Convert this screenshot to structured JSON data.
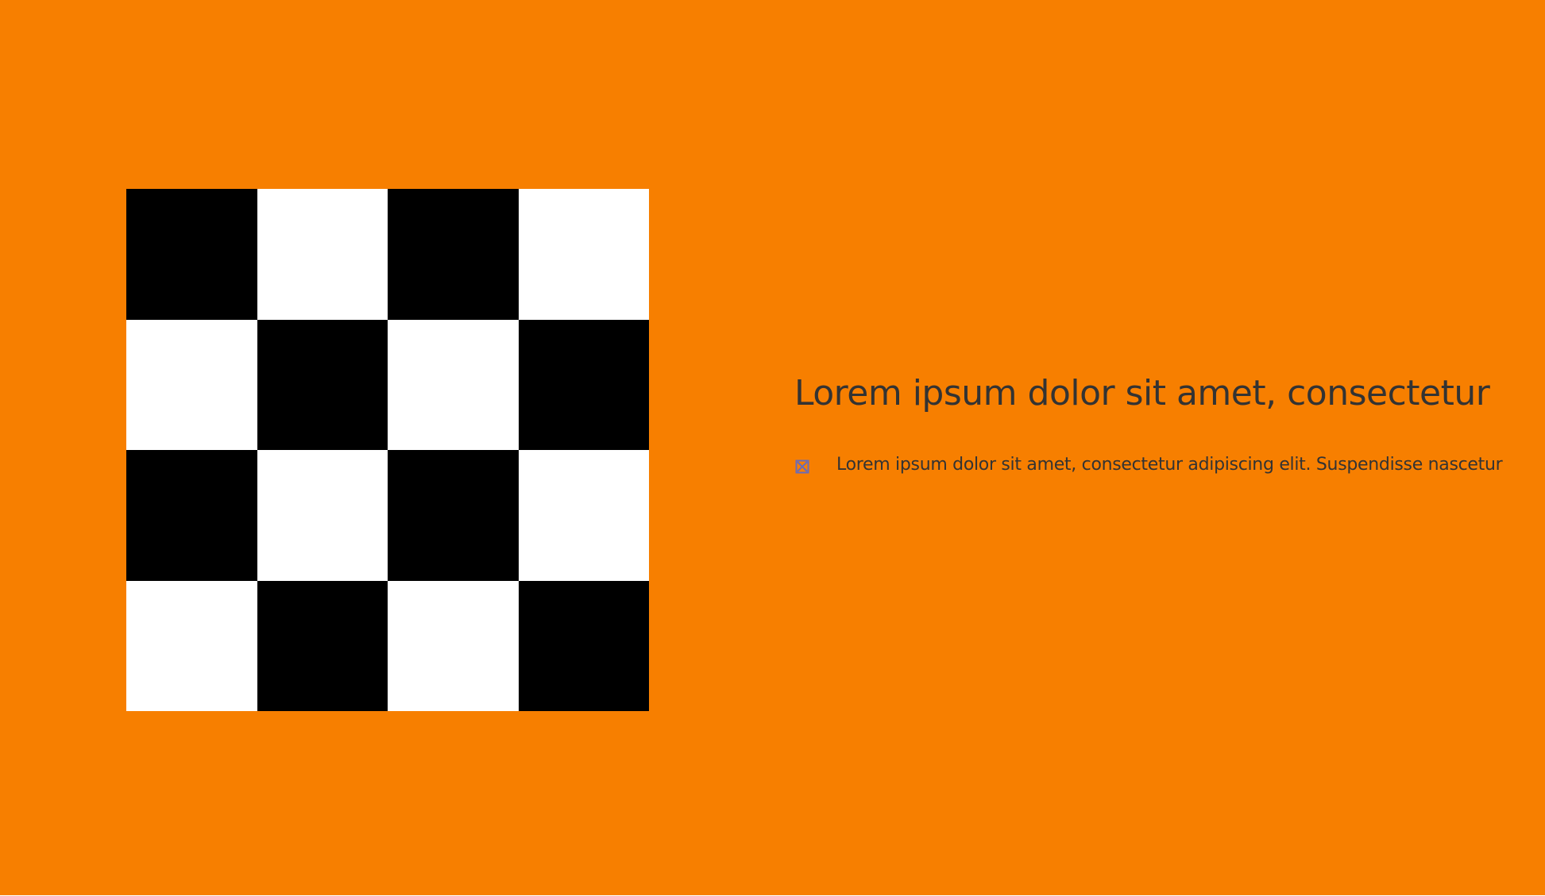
{
  "slide": {
    "background_color": "#f77f00",
    "text_color": "#333333",
    "checkerboard": {
      "rows": 4,
      "cols": 4,
      "pattern": [
        [
          "black",
          "white",
          "black",
          "white"
        ],
        [
          "white",
          "black",
          "white",
          "black"
        ],
        [
          "black",
          "white",
          "black",
          "white"
        ],
        [
          "white",
          "black",
          "white",
          "black"
        ]
      ],
      "colors": {
        "black": "#000000",
        "white": "#ffffff"
      }
    },
    "title": "Lorem ipsum dolor sit amet, consectetur",
    "bullets": [
      {
        "icon": "checkbox-cross-icon",
        "icon_color": "#6a6bb8",
        "text": "Lorem ipsum dolor sit amet, consectetur adipiscing elit. Suspendisse nascetur"
      }
    ]
  }
}
